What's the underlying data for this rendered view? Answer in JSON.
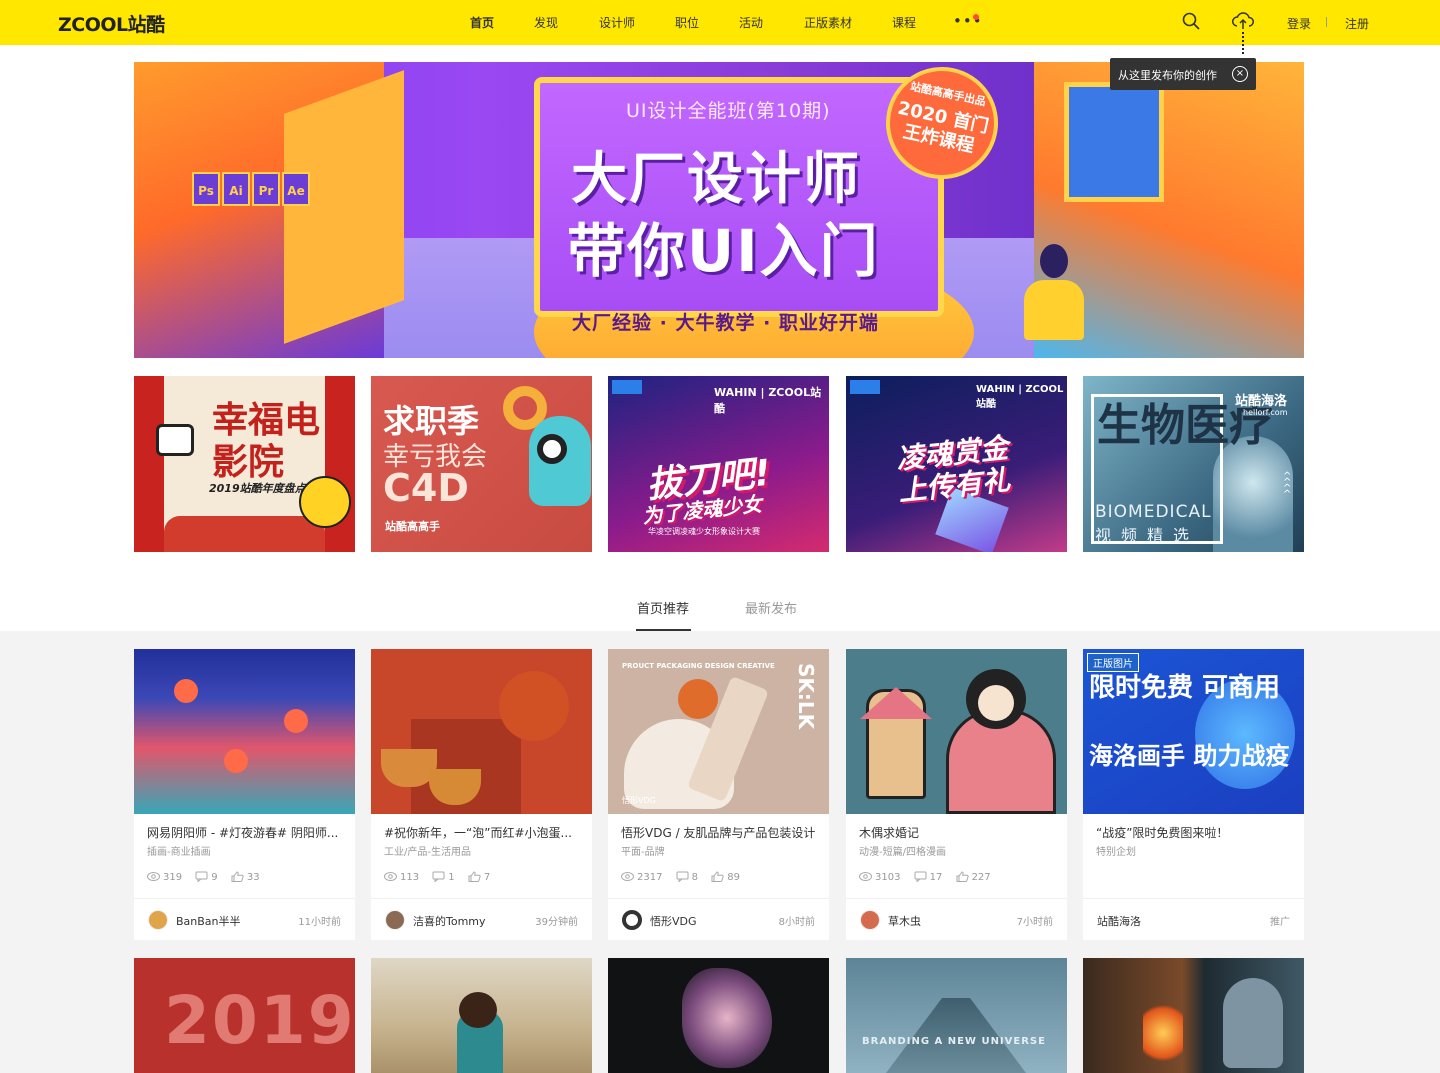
{
  "header": {
    "logo": "ZCOOL站酷",
    "nav": [
      "首页",
      "发现",
      "设计师",
      "职位",
      "活动",
      "正版素材",
      "课程"
    ],
    "more": "•••",
    "login": "登录",
    "register": "注册",
    "accent_color": "#ffe700"
  },
  "tooltip": {
    "text": "从这里发布你的创作",
    "close": "×"
  },
  "hero": {
    "subtitle": "UI设计全能班(第10期)",
    "line1": "大厂设计师",
    "line2": "带你UI入门",
    "tagline": "大厂经验 · 大牛教学 · 职业好开端",
    "badge_top": "站酷高高手出品",
    "badge_main": "2020 首门 王炸课程",
    "soft_tags": [
      "Ps",
      "Ai",
      "Pr",
      "Ae"
    ]
  },
  "sub_banners": [
    {
      "title": "幸福电影院",
      "subtitle": "2019站酷年度盘点"
    },
    {
      "line1": "求职季",
      "line2": "幸亏我会",
      "line3": "C4D",
      "foot": "站酷高高手"
    },
    {
      "brand": "WAHIN | ZCOOL站酷",
      "title": "拔刀吧!",
      "subtitle": "为了凌魂少女",
      "foot": "华凌空调凌魂少女形象设计大赛"
    },
    {
      "brand": "WAHIN | ZCOOL站酷",
      "title": "凌魂赏金",
      "subtitle": "上传有礼"
    },
    {
      "title": "生物医疗",
      "english": "BIOMEDICAL",
      "chinese": "视频精选",
      "brand": "站酷海洛",
      "url": "hellorf.com"
    }
  ],
  "tabs": [
    "首页推荐",
    "最新发布"
  ],
  "cards": [
    {
      "title": "网易阴阳师 - #灯夜游春# 阴阳师...",
      "category": "插画-商业插画",
      "views": "319",
      "comments": "9",
      "likes": "33",
      "author": "BanBan半半",
      "time": "11小时前"
    },
    {
      "title": "#祝你新年，一“泡”而红#小泡蛋...",
      "category": "工业/产品-生活用品",
      "views": "113",
      "comments": "1",
      "likes": "7",
      "author": "洁喜的Tommy",
      "time": "39分钟前"
    },
    {
      "title": "悟形VDG / 友肌品牌与产品包装设计",
      "category": "平面-品牌",
      "views": "2317",
      "comments": "8",
      "likes": "89",
      "author": "悟形VDG",
      "time": "8小时前",
      "image_meta": "PROUCT PACKAGING DESIGN CREATIVE",
      "image_brand": "SK:LK",
      "image_foot": "悟形VDG"
    },
    {
      "title": "木偶求婚记",
      "category": "动漫-短篇/四格漫画",
      "views": "3103",
      "comments": "17",
      "likes": "227",
      "author": "草木虫",
      "time": "7小时前"
    },
    {
      "title": "“战疫”限时免费图来啦！",
      "category": "特别企划",
      "author": "站酷海洛",
      "time": "推广",
      "badge": "正版图片",
      "image_big": "限时免费 可商用",
      "image_small": "海洛画手 助力战疫"
    }
  ],
  "cards_row2": [
    {
      "image_text": "2019"
    },
    {},
    {},
    {
      "image_text": "BRANDING A NEW UNIVERSE"
    },
    {}
  ]
}
